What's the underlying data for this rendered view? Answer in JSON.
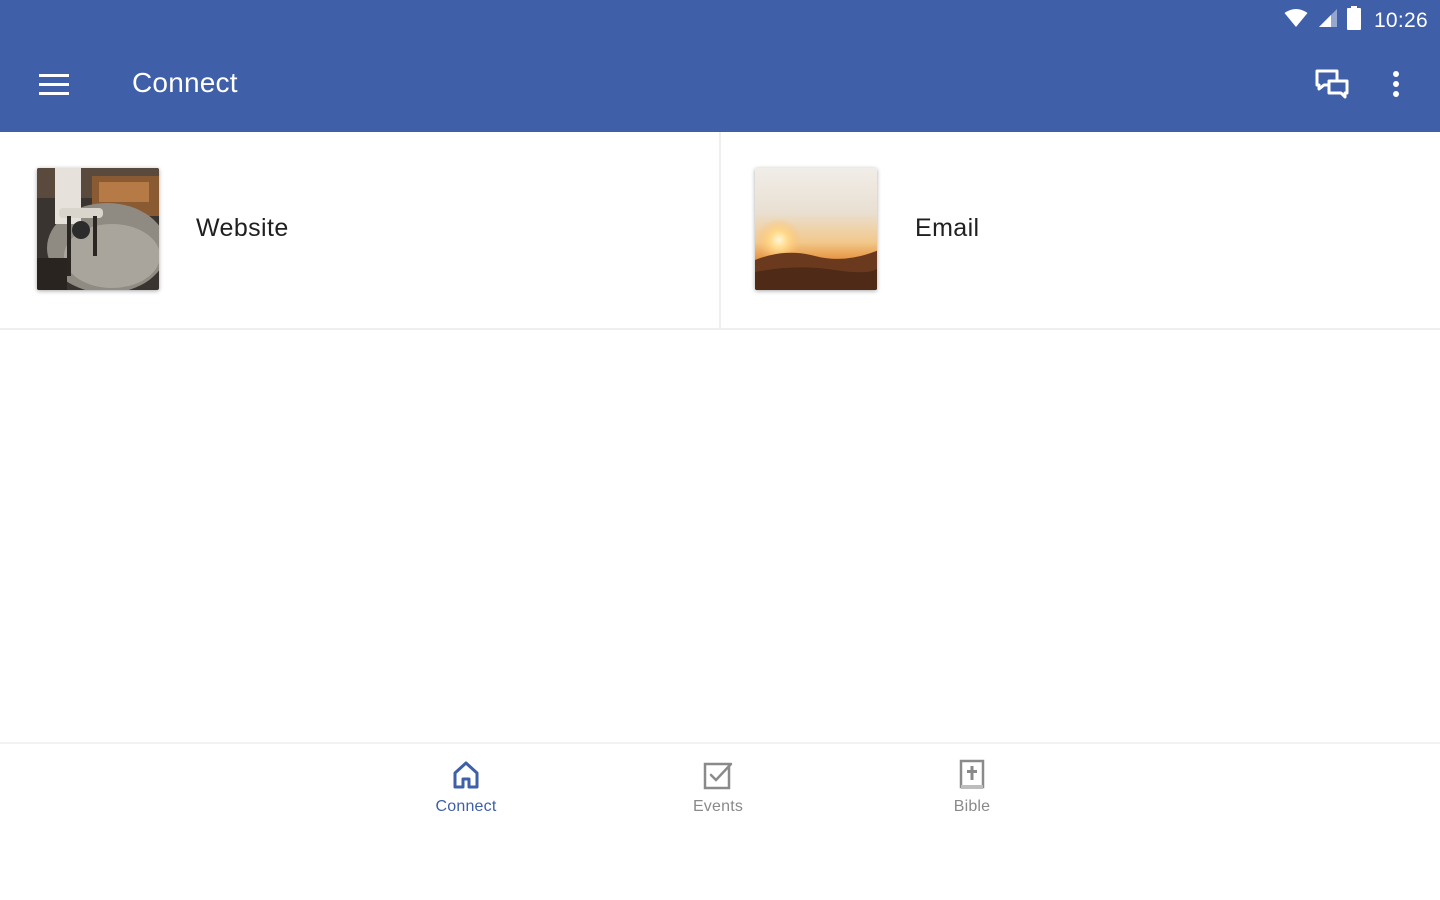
{
  "status_bar": {
    "time": "10:26",
    "icons": [
      "wifi-icon",
      "cell-signal-icon",
      "battery-icon"
    ]
  },
  "app_bar": {
    "title": "Connect",
    "left_icon": "hamburger-menu-icon",
    "right_icons": [
      "chat-icon",
      "more-vert-icon"
    ],
    "background_color": "#3f5fa8"
  },
  "cards": [
    {
      "label": "Website",
      "thumbnail": "interior-photo"
    },
    {
      "label": "Email",
      "thumbnail": "sunset-photo"
    }
  ],
  "bottom_nav": {
    "items": [
      {
        "label": "Connect",
        "icon": "home-icon",
        "active": true
      },
      {
        "label": "Events",
        "icon": "checkbox-icon",
        "active": false
      },
      {
        "label": "Bible",
        "icon": "bible-icon",
        "active": false
      }
    ],
    "active_color": "#3f5fa8",
    "inactive_color": "#8a8a8a"
  }
}
